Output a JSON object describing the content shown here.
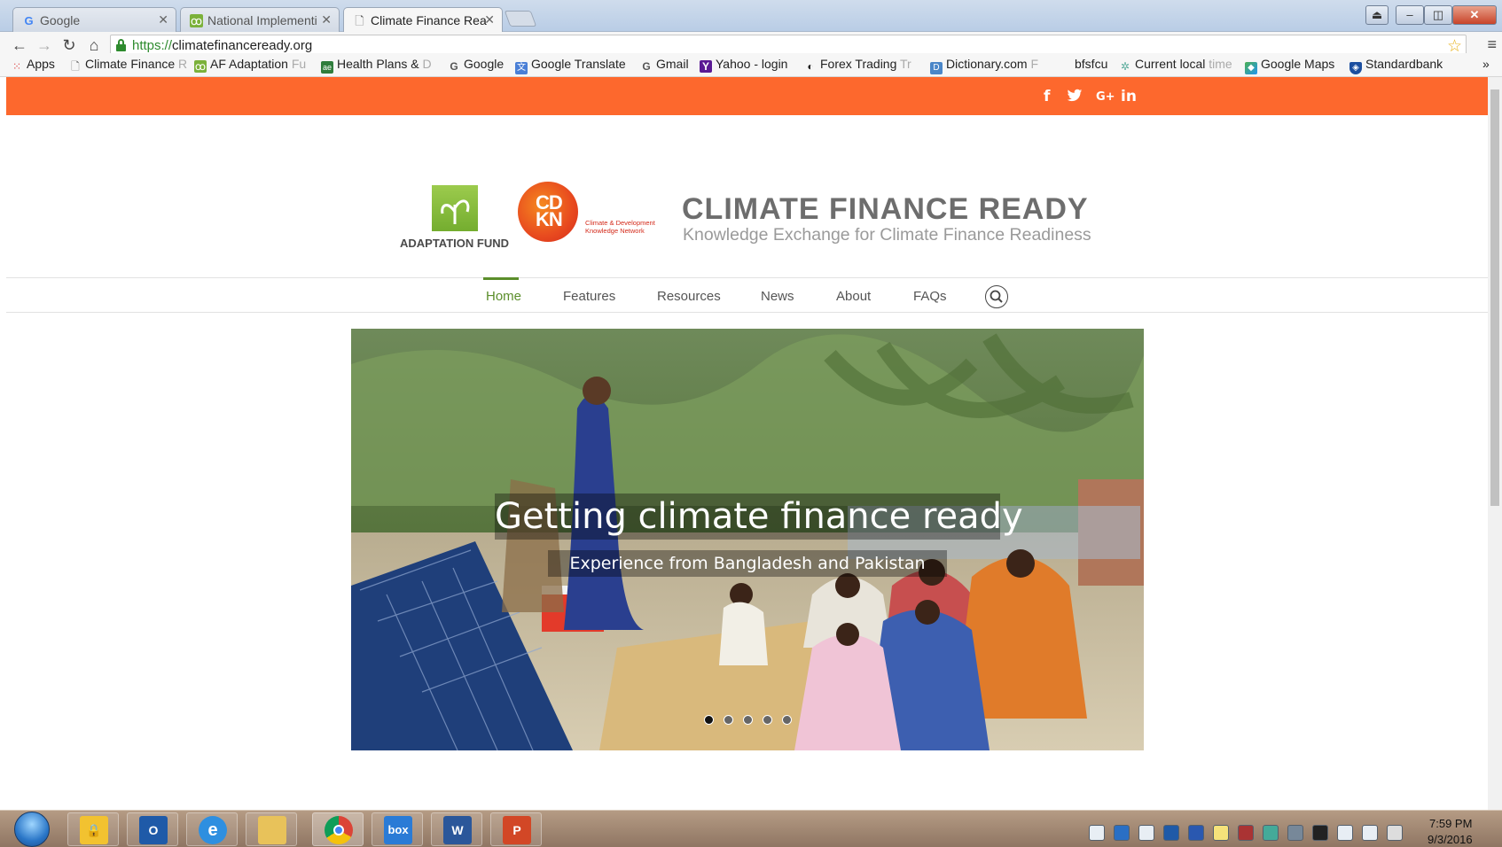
{
  "browser": {
    "tabs": [
      {
        "title": "Google",
        "favicon": "google-g-icon",
        "active": false
      },
      {
        "title": "National Implementi",
        "favicon": "adaptation-fund-icon",
        "active": false
      },
      {
        "title": "Climate Finance Rea",
        "favicon": "page-icon",
        "active": true
      }
    ],
    "url_scheme": "https://",
    "url_host": "climatefinanceready.org",
    "bookmarks": [
      {
        "label": "Apps",
        "icon": "apps-grid-icon",
        "faded": ""
      },
      {
        "label": "Climate Finance ",
        "icon": "page-icon",
        "faded": "R"
      },
      {
        "label": "AF  Adaptation ",
        "icon": "adaptation-fund-icon",
        "faded": "Fu"
      },
      {
        "label": "Health Plans & ",
        "icon": "health-plans-icon",
        "faded": "D"
      },
      {
        "label": "Google",
        "icon": "google-g-icon",
        "faded": ""
      },
      {
        "label": "Google Translate",
        "icon": "translate-icon",
        "faded": ""
      },
      {
        "label": "Gmail",
        "icon": "google-g-icon",
        "faded": ""
      },
      {
        "label": "Yahoo - login",
        "icon": "yahoo-icon",
        "faded": ""
      },
      {
        "label": "Forex Trading ",
        "icon": "forex-icon",
        "faded": "Tr"
      },
      {
        "label": "Dictionary.com ",
        "icon": "dictionary-icon",
        "faded": "F"
      },
      {
        "label": "bfsfcu",
        "icon": "",
        "faded": ""
      },
      {
        "label": "Current local ",
        "icon": "clock-icon",
        "faded": "time"
      },
      {
        "label": "Google Maps",
        "icon": "maps-icon",
        "faded": ""
      },
      {
        "label": "Standardbank",
        "icon": "shield-icon",
        "faded": ""
      }
    ],
    "overflow": "»"
  },
  "site": {
    "social": [
      "f",
      "t",
      "G+",
      "in"
    ],
    "af_logo_text": "ADAPTATION FUND",
    "cdkn_letters": "CD KN",
    "cdkn_tagline_1": "Climate & Development",
    "cdkn_tagline_2": "Knowledge Network",
    "title": "CLIMATE FINANCE READY",
    "tagline": "Knowledge Exchange for Climate Finance Readiness",
    "nav": [
      "Home",
      "Features",
      "Resources",
      "News",
      "About",
      "FAQs"
    ],
    "active_nav": "Home",
    "slide": {
      "headline": "Getting climate finance ready",
      "subtitle": "Experience from Bangladesh and Pakistan",
      "dot_count": 5,
      "active_dot": 1
    }
  },
  "taskbar": {
    "apps": [
      "Security",
      "Outlook",
      "Internet Explorer",
      "File Explorer",
      "Chrome",
      "Box",
      "Word",
      "PowerPoint"
    ],
    "time": "7:59 PM",
    "date": "9/3/2016"
  },
  "colors": {
    "topbar": "#fd682d",
    "nav_active": "#5b8e2b",
    "title_gray": "#6d6d6d"
  }
}
